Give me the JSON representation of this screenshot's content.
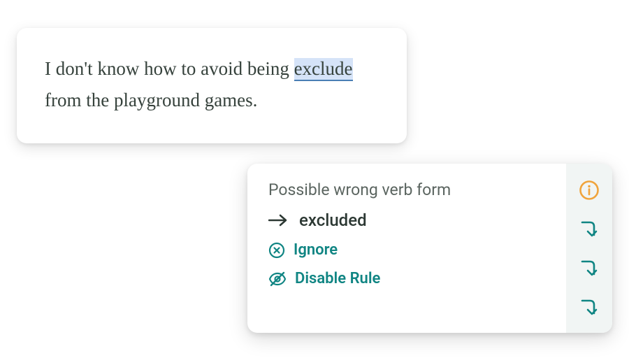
{
  "text": {
    "before": "I don't know how to avoid being ",
    "flagged": "exclude",
    "after": " from the playground games."
  },
  "popup": {
    "title": "Possible wrong verb form",
    "suggestion": "excluded",
    "ignore_label": "Ignore",
    "disable_label": "Disable Rule"
  },
  "colors": {
    "teal": "#108583",
    "orange": "#F0A43C",
    "text": "#36423C",
    "muted": "#5B6560"
  }
}
